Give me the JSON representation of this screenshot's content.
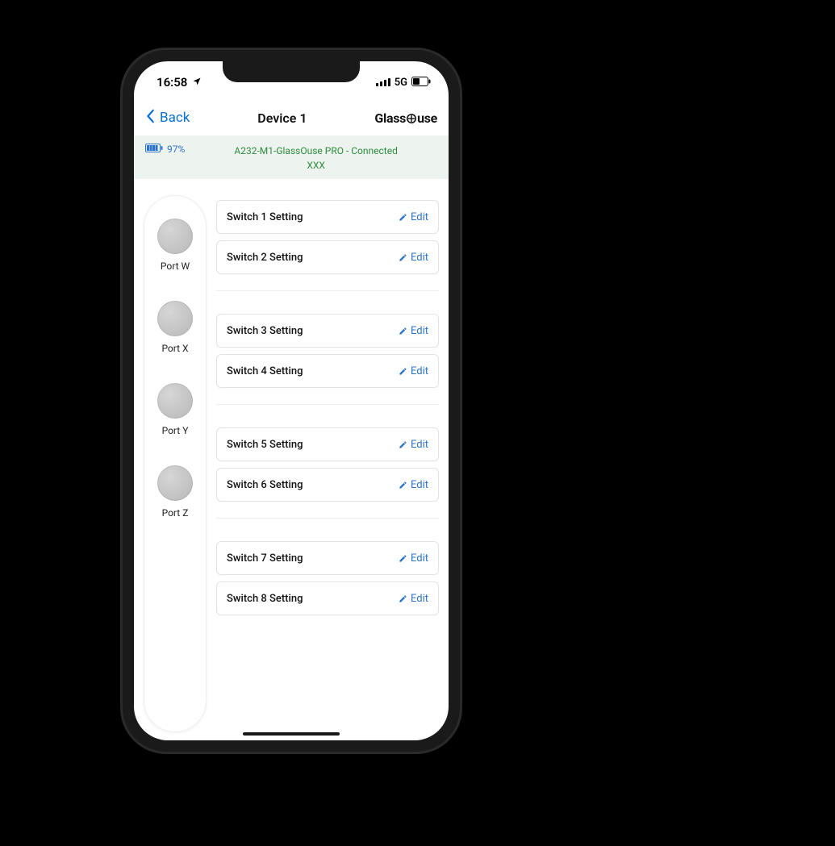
{
  "status_bar": {
    "time": "16:58",
    "network": "5G"
  },
  "nav": {
    "back_label": "Back",
    "title": "Device 1",
    "brand_left": "Glass",
    "brand_right": "use"
  },
  "device_status": {
    "battery_percent": "97%",
    "connection_line1": "A232-M1-GlassOuse PRO  - Connected",
    "connection_line2": "XXX"
  },
  "ports": [
    {
      "label": "Port W"
    },
    {
      "label": "Port X"
    },
    {
      "label": "Port Y"
    },
    {
      "label": "Port Z"
    }
  ],
  "switch_groups": [
    {
      "rows": [
        {
          "label": "Switch 1 Setting",
          "edit": "Edit"
        },
        {
          "label": "Switch 2 Setting",
          "edit": "Edit"
        }
      ]
    },
    {
      "rows": [
        {
          "label": "Switch 3 Setting",
          "edit": "Edit"
        },
        {
          "label": "Switch 4 Setting",
          "edit": "Edit"
        }
      ]
    },
    {
      "rows": [
        {
          "label": "Switch 5 Setting",
          "edit": "Edit"
        },
        {
          "label": "Switch 6 Setting",
          "edit": "Edit"
        }
      ]
    },
    {
      "rows": [
        {
          "label": "Switch 7 Setting",
          "edit": "Edit"
        },
        {
          "label": "Switch 8 Setting",
          "edit": "Edit"
        }
      ]
    }
  ]
}
